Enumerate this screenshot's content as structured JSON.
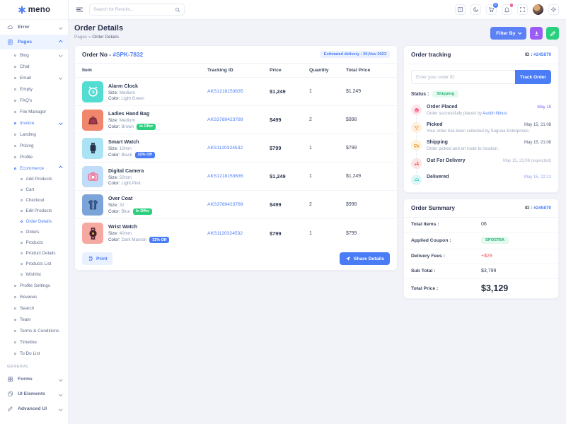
{
  "brand": {
    "name": "meno"
  },
  "topbar": {
    "search_placeholder": "Search for Results...",
    "cart_badge": "5",
    "icons": [
      "translate-icon",
      "dark-mode-icon",
      "cart-icon",
      "notifications-icon",
      "fullscreen-icon",
      "avatar",
      "settings-icon"
    ]
  },
  "page": {
    "title": "Order Details",
    "breadcrumb": {
      "parent": "Pages",
      "separator": "»",
      "current": "Order Details"
    },
    "actions": {
      "filter_label": "Filter By"
    }
  },
  "sidebar": {
    "general_label": "GENERAL",
    "items": [
      {
        "label": "Error"
      },
      {
        "label": "Pages"
      },
      {
        "label": "Blog"
      },
      {
        "label": "Chat"
      },
      {
        "label": "Email"
      },
      {
        "label": "Empty"
      },
      {
        "label": "FAQ's"
      },
      {
        "label": "File Manager"
      },
      {
        "label": "Invoice"
      },
      {
        "label": "Landing"
      },
      {
        "label": "Pricing"
      },
      {
        "label": "Profile"
      },
      {
        "label": "Ecommerce"
      },
      {
        "label": "Add Products"
      },
      {
        "label": "Cart"
      },
      {
        "label": "Checkout"
      },
      {
        "label": "Edit Products"
      },
      {
        "label": "Order Details"
      },
      {
        "label": "Orders"
      },
      {
        "label": "Products"
      },
      {
        "label": "Product Details"
      },
      {
        "label": "Products List"
      },
      {
        "label": "Wishlist"
      },
      {
        "label": "Profile Settings"
      },
      {
        "label": "Reviews"
      },
      {
        "label": "Search"
      },
      {
        "label": "Team"
      },
      {
        "label": "Terms & Conditions"
      },
      {
        "label": "Timeline"
      },
      {
        "label": "To Do List"
      },
      {
        "label": "Forms"
      },
      {
        "label": "UI Elements"
      },
      {
        "label": "Advanced UI"
      }
    ]
  },
  "order": {
    "title_prefix": "Order No -",
    "order_no": "#SPK-7832",
    "delivery_badge": "Estimated delivery : 30,Nov 2023",
    "columns": {
      "item": "Item",
      "tracking": "Tracking ID",
      "price": "Price",
      "qty": "Quantity",
      "total": "Total Price"
    },
    "size_label": "Size:",
    "color_label": "Color:",
    "items": [
      {
        "name": "Alarm Clock",
        "size": "Medium",
        "color": "Light Green",
        "badge": "",
        "tracking_id": "AKS1218153635",
        "price": "$1,249",
        "qty": "1",
        "total": "$1,249"
      },
      {
        "name": "Ladies Hand Bag",
        "size": "Medium",
        "color": "Brown",
        "badge": "In Offer",
        "tracking_id": "AKS3789423789",
        "price": "$499",
        "qty": "2",
        "total": "$998"
      },
      {
        "name": "Smart Watch",
        "size": "10mm",
        "color": "Black",
        "badge": "32% Off",
        "tracking_id": "AKS1120324532",
        "price": "$799",
        "qty": "1",
        "total": "$799"
      },
      {
        "name": "Digital Camera",
        "size": "50mm",
        "color": "Light Pink",
        "badge": "",
        "tracking_id": "AKS1218153635",
        "price": "$1,249",
        "qty": "1",
        "total": "$1,249"
      },
      {
        "name": "Over Coat",
        "size": "32",
        "color": "Blue",
        "badge": "In Offer",
        "tracking_id": "AKS3789423789",
        "price": "$499",
        "qty": "2",
        "total": "$998"
      },
      {
        "name": "Wrist Watch",
        "size": "40mm",
        "color": "Dark Maroon",
        "badge": "32% Off",
        "tracking_id": "AKS1120324532",
        "price": "$799",
        "qty": "1",
        "total": "$799"
      }
    ],
    "print_label": "Print",
    "share_label": "Share Details"
  },
  "tracking": {
    "title": "Order tracking",
    "id_label": "ID :",
    "id_value": "#245879",
    "input_placeholder": "Enter your order ID",
    "track_button": "Track Order",
    "status_label": "Status :",
    "status_value": "Shipping",
    "steps": [
      {
        "title": "Order Placed",
        "desc_prefix": "Order successfully placed by",
        "desc_link": "Austin Ninus",
        "date": "May 15"
      },
      {
        "title": "Picked",
        "desc": "Your order has been collected by Suguna Enterprises.",
        "date": "May 15, 21:08"
      },
      {
        "title": "Shipping",
        "desc": "Order picked and en route to location.",
        "date": "May 15, 21:08"
      },
      {
        "title": "Out For Delivery",
        "date": "May 15, 21:08 (expected)"
      },
      {
        "title": "Delivered",
        "date": "May 15, 22:12"
      }
    ]
  },
  "summary": {
    "title": "Order Summary",
    "id_label": "ID :",
    "id_value": "#245879",
    "total_items_label": "Total Items :",
    "total_items": "06",
    "coupon_label": "Applied Coupon :",
    "coupon": "SPOST8A",
    "delivery_label": "Delivery Fees :",
    "delivery": "+$29",
    "subtotal_label": "Sub Total :",
    "subtotal": "$3,799",
    "total_label": "Total Price :",
    "total": "$3,129"
  },
  "colors": {
    "primary": "#4a7cf6",
    "success": "#2bd07e",
    "purple": "#9a5cf5",
    "danger": "#f3565d",
    "violet": "#7f63f4",
    "badge_bg": "#e9f0ff"
  }
}
